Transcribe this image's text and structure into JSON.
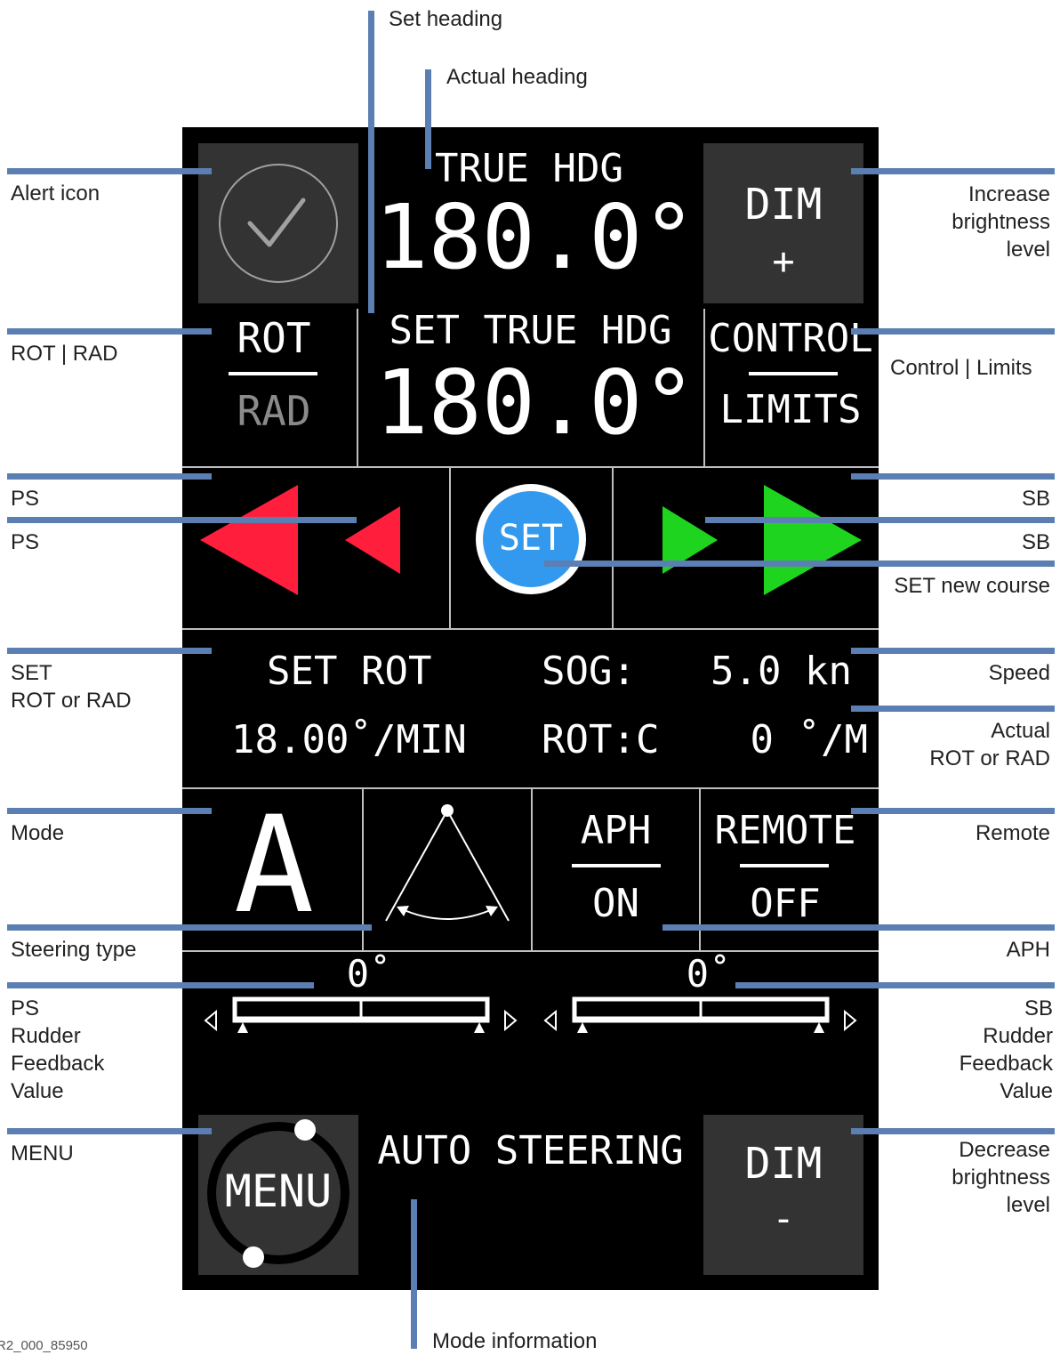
{
  "annotations": {
    "set_heading": "Set heading",
    "actual_heading": "Actual heading",
    "alert_icon": "Alert icon",
    "rot_rad": "ROT | RAD",
    "ps_1": "PS",
    "ps_2": "PS",
    "set_rot_or_rad": "SET\nROT or RAD",
    "mode": "Mode",
    "steering_type": "Steering type",
    "ps_rudder": "PS\nRudder\nFeedback\nValue",
    "menu": "MENU",
    "increase_brightness": "Increase\nbrightness\nlevel",
    "control_limits": "Control | Limits",
    "sb_1": "SB",
    "sb_2": "SB",
    "set_new_course": "SET new course",
    "speed": "Speed",
    "actual_rot_or_rad": "Actual\nROT or RAD",
    "remote": "Remote",
    "aph": "APH",
    "sb_rudder": "SB\nRudder\nFeedback\nValue",
    "decrease_brightness": "Decrease\nbrightness\nlevel",
    "mode_information": "Mode information",
    "figure_id": "R2_000_85950"
  },
  "display": {
    "true_hdg_label": "TRUE HDG",
    "true_hdg_value": "180.0°",
    "set_true_hdg_label": "SET TRUE HDG",
    "set_true_hdg_value": "180.0°",
    "dim_plus_label": "DIM",
    "dim_plus_sign": "+",
    "rot_label": "ROT",
    "rad_label": "RAD",
    "control_label": "CONTROL",
    "limits_label": "LIMITS",
    "set_button": "SET",
    "set_rot_label": "SET ROT",
    "set_rot_value": "18.00˚/MIN",
    "sog_label": "SOG:",
    "sog_value": "5.0 kn",
    "rot_c_label": "ROT:C",
    "rot_c_value": "0 ˚/M",
    "mode_letter": "A",
    "aph_label": "APH",
    "aph_value": "ON",
    "remote_label": "REMOTE",
    "remote_value": "OFF",
    "ps_rudder_value": "0˚",
    "sb_rudder_value": "0˚",
    "menu_label": "MENU",
    "mode_info": "AUTO STEERING",
    "dim_minus_label": "DIM",
    "dim_minus_sign": "-"
  },
  "colors": {
    "panel": "#000000",
    "button": "#333333",
    "ps_arrows": "#ff1f3d",
    "sb_arrows": "#1fd41f",
    "set_button": "#3399ee",
    "leader_lines": "#5b7fb3"
  },
  "icons": {
    "alert": "check-circle-icon",
    "steering_type": "steering-sector-icon"
  }
}
